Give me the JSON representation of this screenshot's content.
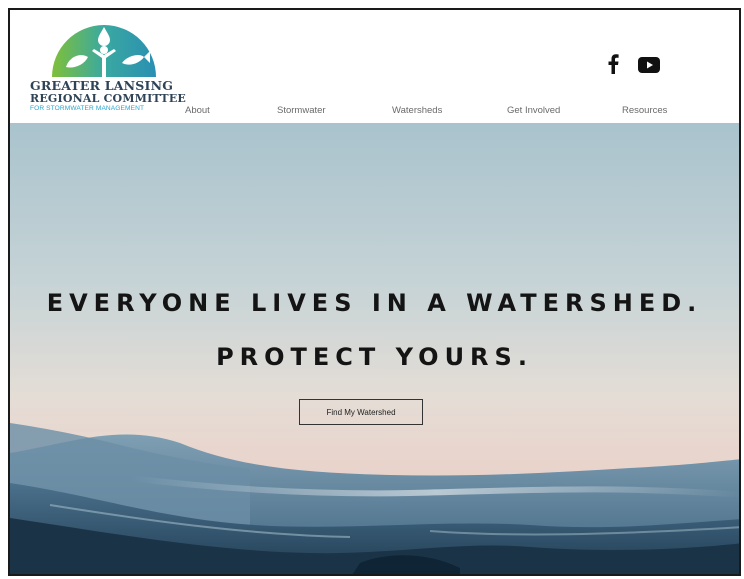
{
  "header": {
    "logo": {
      "line1": "GREATER LANSING",
      "line2": "REGIONAL COMMITTEE",
      "line3": "FOR STORMWATER MANAGEMENT"
    },
    "nav": [
      {
        "label": "About"
      },
      {
        "label": "Stormwater"
      },
      {
        "label": "Watersheds"
      },
      {
        "label": "Get Involved"
      },
      {
        "label": "Resources"
      }
    ],
    "social": [
      {
        "icon": "facebook-icon"
      },
      {
        "icon": "youtube-icon"
      }
    ]
  },
  "hero": {
    "headline_line1": "EVERYONE LIVES IN A WATERSHED.",
    "headline_line2": "PROTECT YOURS.",
    "cta_label": "Find My Watershed"
  },
  "colors": {
    "logo_text": "#2f4357",
    "logo_subtext": "#2aa6cf",
    "logo_teal": "#3aa9a0",
    "logo_green": "#7fbf3a",
    "headline": "#141414",
    "nav_text": "#6a6a6a"
  }
}
